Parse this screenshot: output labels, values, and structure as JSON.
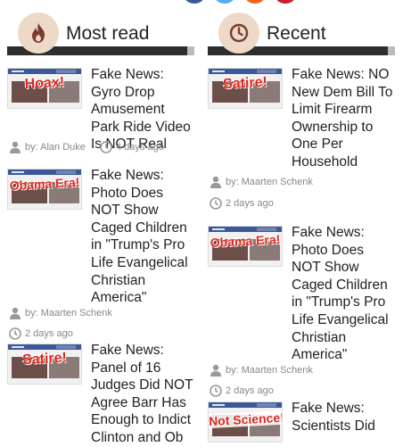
{
  "colors": {
    "accent_red": "#e0261f",
    "header_bar": "#2e2e2e",
    "icon_circle": "#ecd9c7",
    "icon_brown": "#7a3b2e"
  },
  "most_read": {
    "title": "Most read",
    "icon": "flame-icon",
    "articles": [
      {
        "stamp": "Hoax!",
        "headline": "Fake News: Gyro Drop Amusement Park Ride Video Is NOT Real",
        "author": "by: Alan Duke",
        "time": "4 days ago"
      },
      {
        "stamp": "Obama Era!",
        "headline": "Fake News: Photo Does NOT Show Caged Children in \"Trump's Pro Life Evangelical Christian America\"",
        "author": "by: Maarten Schenk",
        "time": "2 days ago"
      },
      {
        "stamp": "Satire!",
        "headline": "Fake News: Panel of 16 Judges Did NOT Agree Barr Has Enough to Indict Clinton and Ob",
        "author": "",
        "time": ""
      }
    ]
  },
  "recent": {
    "title": "Recent",
    "icon": "clock-icon",
    "articles": [
      {
        "stamp": "Satire!",
        "headline": "Fake News: NO New Dem Bill To Limit Firearm Ownership to One Per Household",
        "author": "by: Maarten Schenk",
        "time": "2 days ago"
      },
      {
        "stamp": "Obama Era!",
        "headline": "Fake News: Photo Does NOT Show Caged Children in \"Trump's Pro Life Evangelical Christian America\"",
        "author": "by: Maarten Schenk",
        "time": "2 days ago"
      },
      {
        "stamp": "Not Science!",
        "headline": "Fake News: Scientists Did",
        "author": "",
        "time": ""
      }
    ]
  }
}
